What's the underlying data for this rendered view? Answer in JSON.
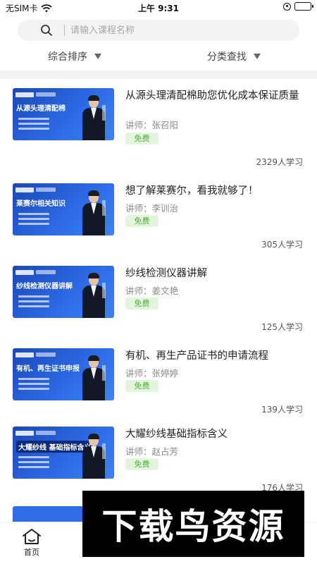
{
  "status_bar": {
    "carrier": "无SIM卡",
    "time": "上午 9:31"
  },
  "search": {
    "placeholder": "请输入课程名称"
  },
  "filters": {
    "sort_label": "综合排序",
    "category_label": "分类查找"
  },
  "courses": [
    {
      "title": "从源头理清配棉助您优化成本保证质量",
      "teacher": "讲师：张召阳",
      "tag": "免费",
      "learners": "2329人学习",
      "thumb_title": "从源头理清配棉"
    },
    {
      "title": "想了解莱赛尔，看我就够了！",
      "teacher": "讲师：李训治",
      "tag": "免费",
      "learners": "305人学习",
      "thumb_title": "莱赛尔相关知识"
    },
    {
      "title": "纱线检测仪器讲解",
      "teacher": "讲师：姜文艳",
      "tag": "免费",
      "learners": "125人学习",
      "thumb_title": "纱线检测仪器讲解"
    },
    {
      "title": "有机、再生产品证书的申请流程",
      "teacher": "讲师：张婷婷",
      "tag": "免费",
      "learners": "139人学习",
      "thumb_title": "有机、再生证书申报"
    },
    {
      "title": "大耀纱线基础指标含义",
      "teacher": "讲师：赵占芳",
      "tag": "免费",
      "learners": "176人学习",
      "thumb_title": "大耀纱线 基础指标含义"
    }
  ],
  "tabbar": {
    "home_label": "首页"
  },
  "watermark": {
    "text": "下载鸟资源"
  },
  "colors": {
    "accent_green": "#4caf3a",
    "tag_bg": "#e4f5de",
    "thumb_blue": "#2e6ce8"
  }
}
